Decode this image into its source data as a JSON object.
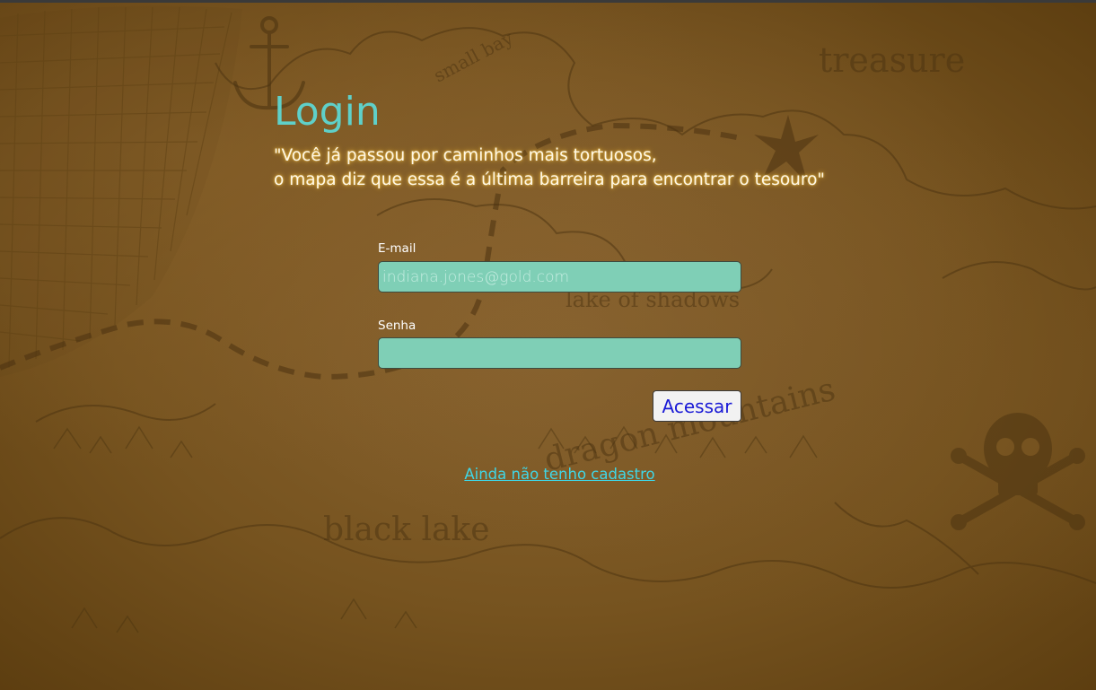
{
  "page": {
    "title": "Login",
    "quote_line_1": "\"Você já passou por caminhos mais tortuosos,",
    "quote_line_2": "o mapa diz que essa é a última barreira para encontrar o tesouro\""
  },
  "form": {
    "email_label": "E-mail",
    "email_placeholder": "indiana.jones@gold.com",
    "email_value": "",
    "password_label": "Senha",
    "password_value": "",
    "submit_label": "Acessar"
  },
  "register_link": {
    "label": "Ainda não tenho cadastro"
  },
  "map": {
    "labels": [
      "treasure",
      "small bay",
      "lake of shadows",
      "dragon mountains",
      "black lake"
    ],
    "icons": [
      "anchor-icon",
      "compass-star-icon",
      "skull-crossbones-icon",
      "fishing-net-icon"
    ]
  },
  "colors": {
    "title": "#5fd0c9",
    "input_background": "#7fcfb6",
    "link": "#3fd6e6",
    "button_text": "#1a1ad6",
    "quote_glow": "#ffc83c"
  }
}
